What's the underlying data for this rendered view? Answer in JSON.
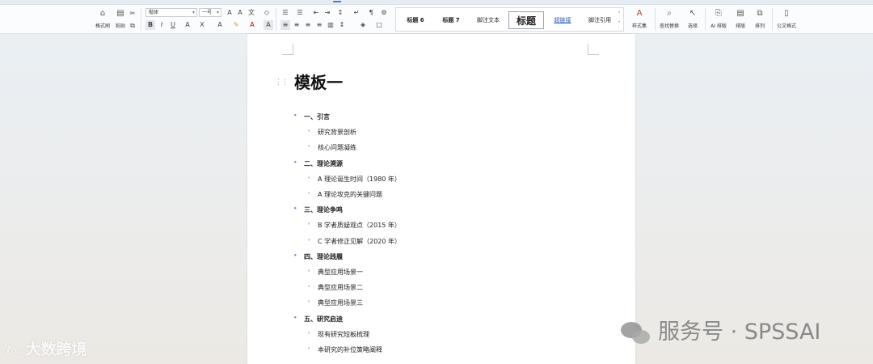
{
  "ribbon": {
    "format_painter_label": "格式刷",
    "paste_label": "粘贴",
    "font_name": "楷体",
    "font_size": "一号",
    "styles": [
      "标题 6",
      "标题 7",
      "脚注文本",
      "标题",
      "超链接",
      "脚注引用"
    ],
    "style_set_label": "样式集",
    "find_replace_label": "查找替换",
    "select_label": "选择",
    "ai_layout_label": "AI 排版",
    "layout_label": "排版",
    "arrange_label": "排列",
    "official_doc_label": "公文格式"
  },
  "document": {
    "title": "模板一",
    "outline": [
      {
        "level": 1,
        "text": "一、引言"
      },
      {
        "level": 2,
        "text": "研究背景剖析"
      },
      {
        "level": 2,
        "text": "核心问题凝练"
      },
      {
        "level": 1,
        "text": "二、理论溯源"
      },
      {
        "level": 2,
        "text": "A 理论诞生时间（1980 年）"
      },
      {
        "level": 2,
        "text": "A 理论攻克的关键问题"
      },
      {
        "level": 1,
        "text": "三、理论争鸣"
      },
      {
        "level": 2,
        "text": "B 学者质疑观点（2015 年）"
      },
      {
        "level": 2,
        "text": "C 学者修正见解（2020 年）"
      },
      {
        "level": 1,
        "text": "四、理论践履"
      },
      {
        "level": 2,
        "text": "典型应用场景一"
      },
      {
        "level": 2,
        "text": "典型应用场景二"
      },
      {
        "level": 2,
        "text": "典型应用场景三"
      },
      {
        "level": 1,
        "text": "五、研究启迪"
      },
      {
        "level": 2,
        "text": "现有研究短板梳理"
      },
      {
        "level": 2,
        "text": "本研究的补位策略阐释"
      }
    ]
  },
  "watermarks": {
    "left": "大数跨境",
    "right": "服务号 · SPSSAI"
  },
  "colors": {
    "accent": "#4a7bd0",
    "bullet_l1": "#6b8fd6",
    "bullet_l2": "#b0b8c4"
  }
}
